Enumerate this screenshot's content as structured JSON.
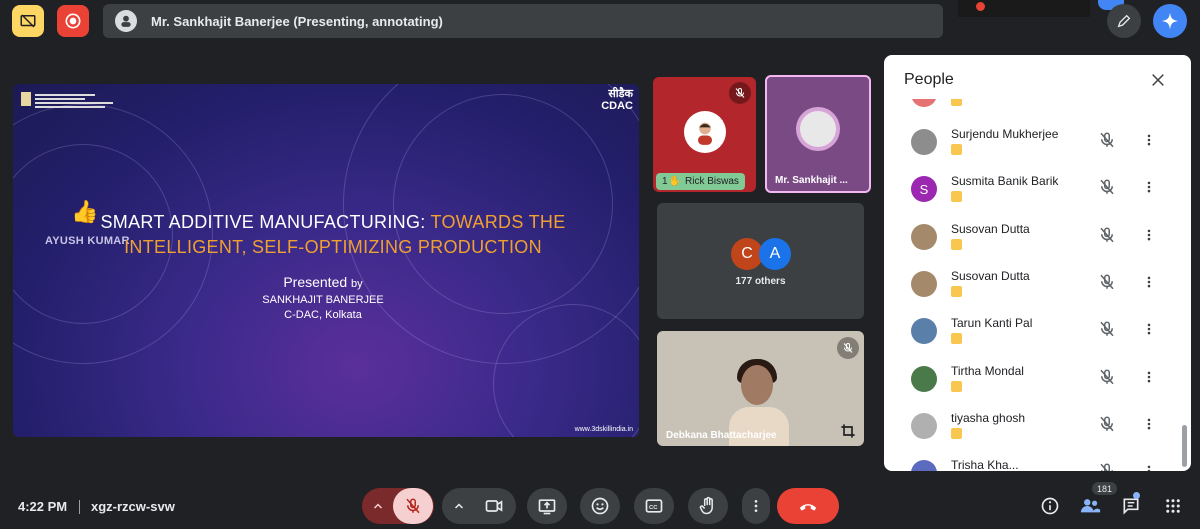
{
  "topbar": {
    "presenting_text": "Mr. Sankhajit Banerjee (Presenting, annotating)"
  },
  "slide": {
    "title_white": "SMART ADDITIVE MANUFACTURING: ",
    "title_orange": "TOWARDS THE",
    "title_line2": "INTELLIGENT, SELF-OPTIMIZING PRODUCTION",
    "presented": "Presented",
    "by": "by",
    "presenter_name": "SANKHAJIT BANERJEE",
    "presenter_org": "C-DAC, Kolkata",
    "url": "www.3dskillindia.in",
    "overlay_name": "AYUSH KUMAR",
    "cdac_logo_hindi": "सीडैक",
    "cdac_logo": "CDAC",
    "ministry_label": "ELECTRONICS AND INFORMATION TECHNOLOGY"
  },
  "tiles": {
    "rick": {
      "hand_count": "1",
      "name": "Rick Biswas"
    },
    "sankhajit": {
      "name": "Mr. Sankhajit ..."
    },
    "others": {
      "avatar_1": "C",
      "avatar_2": "A",
      "label": "177 others"
    },
    "debkana": {
      "name": "Debkana Bhattacharjee"
    }
  },
  "people_panel": {
    "title": "People",
    "participants": [
      {
        "name": "Surjendu Mukherjee",
        "avatar_letter": "",
        "avatar_color": "#8d8d8d"
      },
      {
        "name": "Susmita Banik Barik",
        "avatar_letter": "S",
        "avatar_color": "#9c27b0"
      },
      {
        "name": "Susovan Dutta",
        "avatar_letter": "",
        "avatar_color": "#a48a6a"
      },
      {
        "name": "Susovan Dutta",
        "avatar_letter": "",
        "avatar_color": "#a48a6a"
      },
      {
        "name": "Tarun Kanti Pal",
        "avatar_letter": "",
        "avatar_color": "#5a7fa8"
      },
      {
        "name": "Tirtha Mondal",
        "avatar_letter": "",
        "avatar_color": "#4a7a4a"
      },
      {
        "name": "tiyasha ghosh",
        "avatar_letter": "",
        "avatar_color": "#b0b0b0"
      },
      {
        "name": "Trisha Kha...",
        "avatar_letter": "",
        "avatar_color": "#5c6bc0"
      }
    ]
  },
  "bottombar": {
    "time": "4:22 PM",
    "meeting_code": "xgz-rzcw-svw",
    "participant_count": "181"
  },
  "colors": {
    "background": "#202124",
    "leave": "#ea4335",
    "mic_off": "#f6d0d0",
    "accent_blue": "#4285f4"
  }
}
